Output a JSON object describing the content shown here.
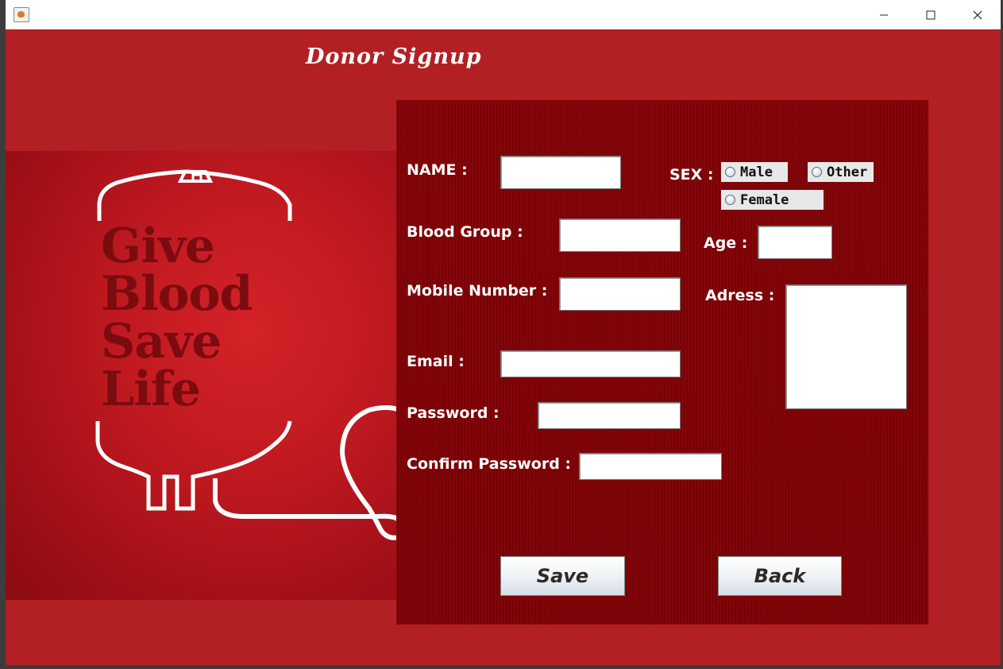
{
  "window": {
    "minimize_icon": "minimize-icon",
    "maximize_icon": "maximize-icon",
    "close_icon": "close-icon",
    "background": "#b32024"
  },
  "header": {
    "title": "Donor Signup"
  },
  "poster": {
    "lines": [
      "Give",
      "Blood",
      "Save",
      "Life"
    ],
    "background": "#c21a21"
  },
  "form": {
    "name_label": "NAME  :",
    "name_value": "",
    "blood_group_label": "Blood Group  :",
    "blood_group_value": "",
    "mobile_label": "Mobile Number  :",
    "mobile_value": "",
    "email_label": "Email  :",
    "email_value": "",
    "password_label": "Password  :",
    "password_value": "",
    "confirm_password_label": "Confirm Password  :",
    "confirm_password_value": "",
    "sex_label": "SEX  :",
    "sex_options": [
      "Male",
      "Other",
      "Female"
    ],
    "age_label": "Age  :",
    "age_value": "",
    "address_label": "Adress  :",
    "address_value": "",
    "panel_color": "#7e0206"
  },
  "buttons": {
    "save_label": "Save",
    "back_label": "Back"
  }
}
